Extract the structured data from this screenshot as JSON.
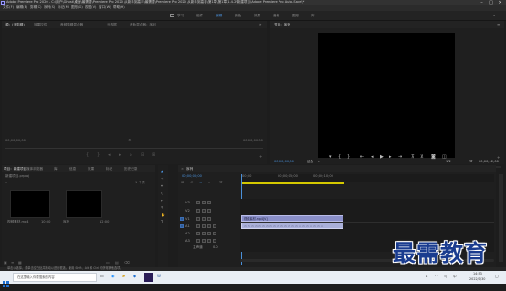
{
  "title_bar": {
    "title": "Adobe Premiere Pro 2020 - C:\\用户\\Ghost\\桌面\\最需要\\Premiere Pro 2020 从新手到高手\\最需要\\Premiere Pro 2020 从新手到高手\\第1章\\第1章\\1.4.2\\新建项目\\Adobe Premiere Pro Auto-Save\\*"
  },
  "menu": [
    "文件(F)",
    "编辑(E)",
    "剪辑(C)",
    "序列(S)",
    "标记(M)",
    "图形(G)",
    "视图(V)",
    "窗口(W)",
    "帮助(H)"
  ],
  "workspaces": [
    "学习",
    "组件",
    "编辑",
    "颜色",
    "效果",
    "音频",
    "图形",
    "库"
  ],
  "active_workspace": "编辑",
  "source_panel": {
    "tabs": [
      "源：(无剪辑)",
      "效果控件",
      "音频剪辑混合器",
      "元数据",
      "音轨混合器：序列"
    ],
    "timecode_left": "00;00;00;00",
    "timecode_right": "00;00;00;00"
  },
  "program_panel": {
    "tab": "节目：序列",
    "timecode": "00;00;00;00",
    "fit": "适合",
    "ratio": "1/2",
    "duration": "00;00;12;00"
  },
  "project_panel": {
    "tabs": [
      "项目：新建项目",
      "媒体浏览器",
      "库",
      "信息",
      "效果",
      "标记",
      "历史记录"
    ],
    "project_file": "新建项目.prproj",
    "count": "1 个项",
    "items": [
      {
        "name": "视频素材.mp4",
        "duration": "10;00"
      },
      {
        "name": "序列",
        "duration": "12;00"
      }
    ]
  },
  "timeline_panel": {
    "tab": "序列",
    "timecode": "00;00;00;00",
    "ruler": [
      "00;00",
      "00;00;05;00",
      "00;00;10;00"
    ],
    "tracks": {
      "video": [
        "V3",
        "V2",
        "V1"
      ],
      "audio": [
        "A1",
        "A2",
        "A3"
      ],
      "master": "主声道",
      "master_value": "0.0"
    },
    "clips": {
      "video": "视频素材.mp4[V]",
      "audio": "音频"
    }
  },
  "status_bar": {
    "text": "单击以选择，或单击空白处并拖动以进行框选。使用 Shift、Alt 和 Ctrl 可获得其他选项。"
  },
  "taskbar": {
    "search_placeholder": "在这里输入你要搜索的内容",
    "time": "14:53",
    "date": "2022/1/30",
    "ime": "中"
  },
  "watermark": "最需教育",
  "colors": {
    "accent": "#4a90d9",
    "video_clip": "#8a8fc9",
    "audio_clip": "#aab0d9",
    "playhead_bar": "#d4c800"
  }
}
